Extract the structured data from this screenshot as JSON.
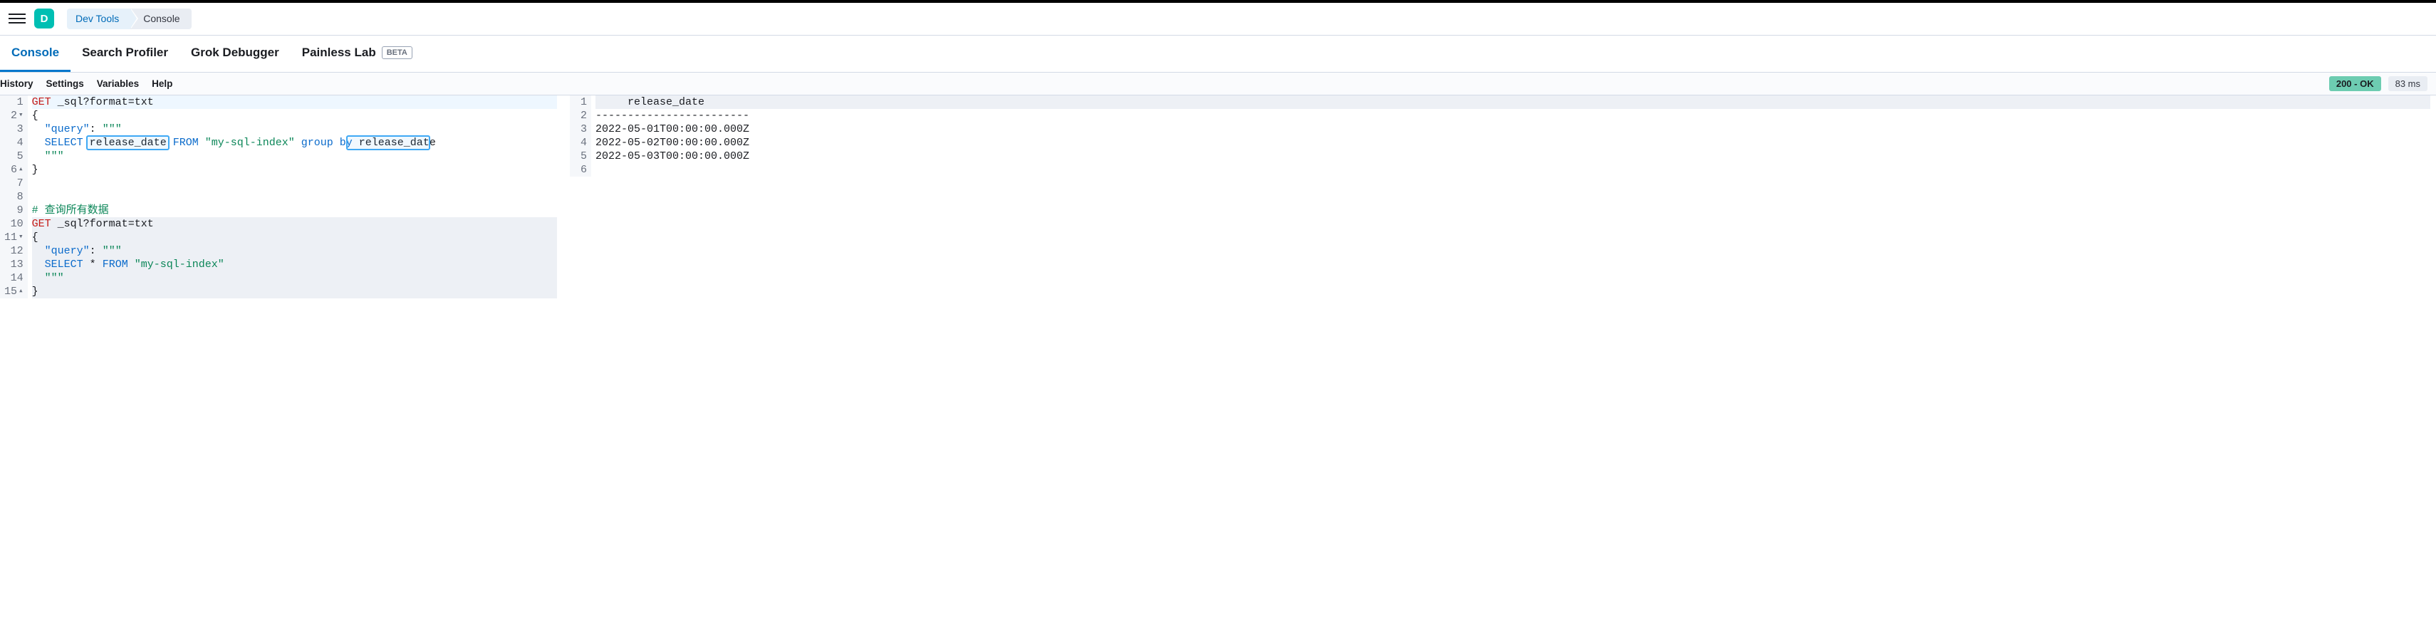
{
  "header": {
    "logo_letter": "D",
    "breadcrumbs": [
      "Dev Tools",
      "Console"
    ]
  },
  "tabs": [
    {
      "label": "Console",
      "active": true
    },
    {
      "label": "Search Profiler",
      "active": false
    },
    {
      "label": "Grok Debugger",
      "active": false
    },
    {
      "label": "Painless Lab",
      "active": false,
      "badge": "BETA"
    }
  ],
  "subtabs": [
    "History",
    "Settings",
    "Variables",
    "Help"
  ],
  "status": {
    "code": "200 - OK",
    "timing": "83 ms"
  },
  "request_editor": {
    "highlight_field": "release_date",
    "lines": [
      {
        "n": 1,
        "type": "req",
        "method": "GET",
        "url": "_sql?format=txt",
        "hl": true
      },
      {
        "n": 2,
        "fold": "open",
        "raw": "{"
      },
      {
        "n": 3,
        "raw_html": "  <span class='tok-key'>\"query\"</span><span class='tok-punct'>:</span> <span class='tok-strval'>\"\"\"</span>"
      },
      {
        "n": 4,
        "raw_html": "  <span class='tok-kw'>SELECT</span> release_date <span class='tok-kw'>FROM</span> <span class='tok-strval'>\"my-sql-index\"</span> <span class='tok-kw'>group by</span> release_date"
      },
      {
        "n": 5,
        "raw_html": "  <span class='tok-strval'>\"\"\"</span>"
      },
      {
        "n": 6,
        "fold": "close",
        "raw": "}"
      },
      {
        "n": 7,
        "raw": ""
      },
      {
        "n": 8,
        "raw": ""
      },
      {
        "n": 9,
        "raw_html": "<span class='tok-comment'># 查询所有数据</span>"
      },
      {
        "n": 10,
        "type": "req",
        "method": "GET",
        "url": "_sql?format=txt",
        "active": true,
        "runnable": true
      },
      {
        "n": 11,
        "fold": "open",
        "raw": "{",
        "active_block": true
      },
      {
        "n": 12,
        "raw_html": "  <span class='tok-key'>\"query\"</span><span class='tok-punct'>:</span> <span class='tok-strval'>\"\"\"</span>",
        "active_block": true
      },
      {
        "n": 13,
        "raw_html": "  <span class='tok-kw'>SELECT</span> * <span class='tok-kw'>FROM</span> <span class='tok-strval'>\"my-sql-index\"</span>",
        "active_block": true
      },
      {
        "n": 14,
        "raw_html": "  <span class='tok-strval'>\"\"\"</span>",
        "active_block": true
      },
      {
        "n": 15,
        "fold": "close",
        "raw": "}",
        "active_block": true
      }
    ]
  },
  "response_editor": {
    "lines": [
      {
        "n": 1,
        "text": "     release_date      ",
        "head": true
      },
      {
        "n": 2,
        "text": "------------------------"
      },
      {
        "n": 3,
        "text": "2022-05-01T00:00:00.000Z"
      },
      {
        "n": 4,
        "text": "2022-05-02T00:00:00.000Z"
      },
      {
        "n": 5,
        "text": "2022-05-03T00:00:00.000Z"
      },
      {
        "n": 6,
        "text": ""
      }
    ]
  }
}
